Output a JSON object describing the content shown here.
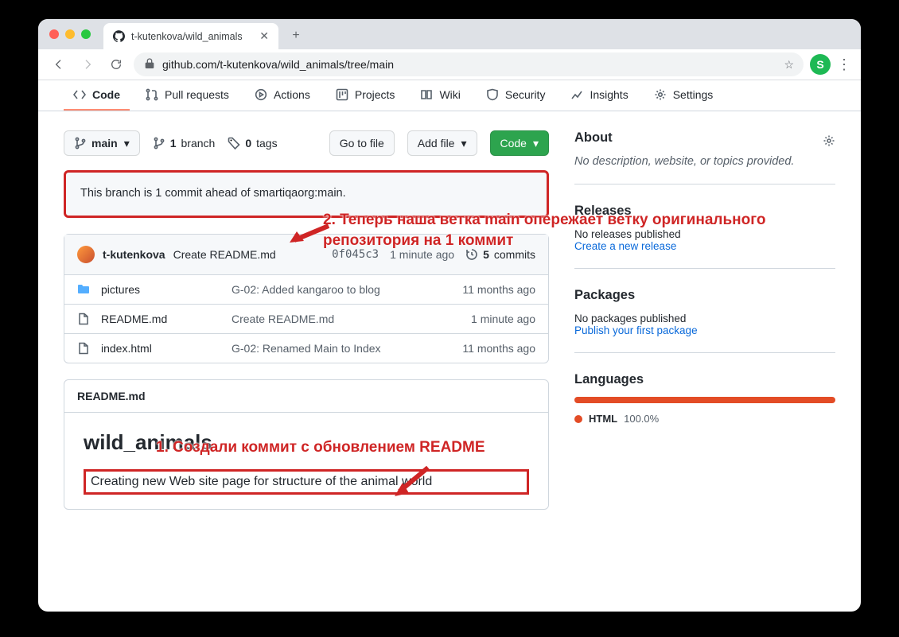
{
  "browser": {
    "tab_title": "t-kutenkova/wild_animals",
    "url": "github.com/t-kutenkova/wild_animals/tree/main",
    "profile_letter": "S"
  },
  "nav": {
    "code": "Code",
    "pulls": "Pull requests",
    "actions": "Actions",
    "projects": "Projects",
    "wiki": "Wiki",
    "security": "Security",
    "insights": "Insights",
    "settings": "Settings"
  },
  "controls": {
    "branch": "main",
    "branches_count": "1",
    "branches_label": "branch",
    "tags_count": "0",
    "tags_label": "tags",
    "go_to_file": "Go to file",
    "add_file": "Add file",
    "code_btn": "Code"
  },
  "notice": "This branch is 1 commit ahead of smartiqaorg:main.",
  "commit": {
    "author": "t-kutenkova",
    "message": "Create README.md",
    "sha": "0f045c3",
    "when": "1 minute ago",
    "commits_count": "5",
    "commits_label": "commits"
  },
  "files": [
    {
      "icon": "dir",
      "name": "pictures",
      "msg": "G-02: Added kangaroo to blog",
      "when": "11 months ago"
    },
    {
      "icon": "file",
      "name": "README.md",
      "msg": "Create README.md",
      "when": "1 minute ago"
    },
    {
      "icon": "file",
      "name": "index.html",
      "msg": "G-02: Renamed Main to Index",
      "when": "11 months ago"
    }
  ],
  "readme": {
    "filename": "README.md",
    "heading": "wild_animals",
    "desc": "Creating new Web site page for structure of the animal world"
  },
  "about": {
    "title": "About",
    "desc": "No description, website, or topics provided."
  },
  "releases": {
    "title": "Releases",
    "none": "No releases published",
    "link": "Create a new release"
  },
  "packages": {
    "title": "Packages",
    "none": "No packages published",
    "link": "Publish your first package"
  },
  "languages": {
    "title": "Languages",
    "primary_name": "HTML",
    "primary_pct": "100.0%"
  },
  "annotations": {
    "a2": "2. Теперь наша ветка main опережает ветку оригинального репозитория на 1 коммит",
    "a1": "1. Создали коммит с обновлением README"
  }
}
